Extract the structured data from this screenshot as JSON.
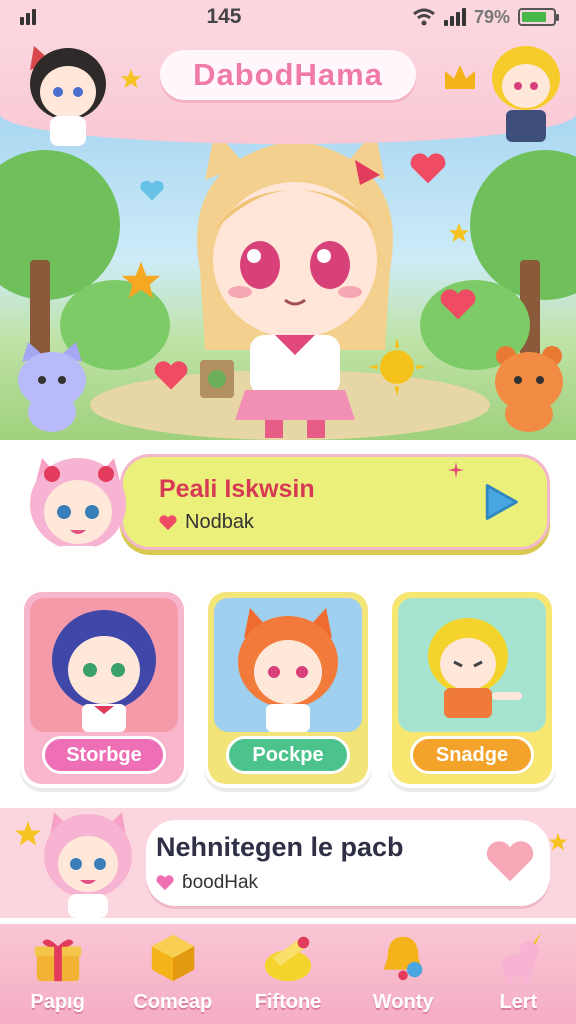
{
  "status": {
    "time": "145",
    "battery": "79%",
    "battery_level": 0.79
  },
  "app": {
    "title": "DabodHama"
  },
  "feature": {
    "title": "Peali Iskwsin",
    "subtitle": "Nodbak"
  },
  "tiles": [
    {
      "label": "Storbge",
      "bg": "#f7b6cc",
      "inner": "#f59aa8",
      "pill": "#ee6fb5"
    },
    {
      "label": "Pockpe",
      "bg": "#f3e47a",
      "inner": "#9fd0ef",
      "pill": "#4cc38c"
    },
    {
      "label": "Snadge",
      "bg": "#f7e66f",
      "inner": "#a6e4cf",
      "pill": "#f3a22a"
    }
  ],
  "banner": {
    "title": "Nehnitegen le pacb",
    "subtitle": "ɓoodHak"
  },
  "nav": [
    {
      "label": "Papıg",
      "icon": "gift-icon"
    },
    {
      "label": "Comeap",
      "icon": "cube-icon"
    },
    {
      "label": "Fiftone",
      "icon": "ticket-icon"
    },
    {
      "label": "Wonty",
      "icon": "bell-icon"
    },
    {
      "label": "Lert",
      "icon": "unicorn-icon"
    }
  ],
  "colors": {
    "accent_pink": "#f07aa8",
    "heart": "#ef4b63"
  }
}
